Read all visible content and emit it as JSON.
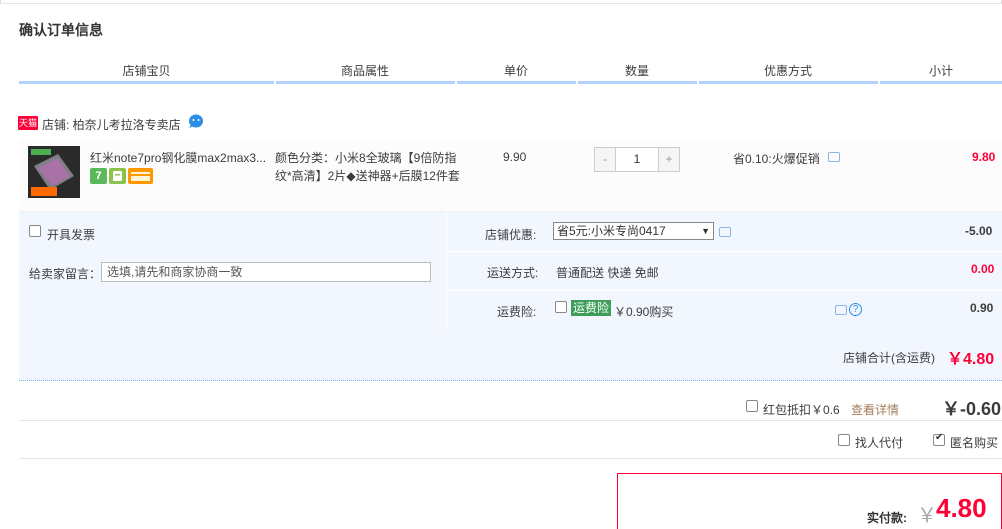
{
  "page": {
    "title": "确认订单信息",
    "columns": [
      "店铺宝贝",
      "商品属性",
      "单价",
      "数量",
      "优惠方式",
      "小计"
    ]
  },
  "shop": {
    "tag": "天猫",
    "label": "店铺: 柏奈儿考拉洛专卖店"
  },
  "item": {
    "name": "红米note7pro钢化膜max2max3...",
    "attrs": "颜色分类：小米8全玻璃【9倍防指纹*高清】2片◆送神器+后膜12件套",
    "price": "9.90",
    "quantity": "1",
    "minus": "-",
    "plus": "+",
    "promo": "省0.10:火爆促销",
    "subtotal": "9.80",
    "badge_text": "7"
  },
  "options": {
    "invoice_label": "开具发票",
    "memo_label": "给卖家留言：",
    "memo_value": "选填,请先和商家协商一致",
    "shop_discount_label": "店铺优惠:",
    "shop_discount_selected": "省5元:小米专尚0417",
    "shop_discount_amount": "-5.00",
    "delivery_label": "运送方式:",
    "delivery_value": "普通配送 快递 免邮",
    "delivery_amount": "0.00",
    "insurance_label": "运费险:",
    "insurance_tag": "运费险",
    "insurance_price": "￥0.90购买",
    "insurance_amount": "0.90"
  },
  "totals": {
    "shop_total_label": "店铺合计(含运费)",
    "shop_total_value": "￥4.80",
    "redpack_label": "红包抵扣￥0.6",
    "redpack_link": "查看详情",
    "redpack_value": "￥-0.60",
    "proxy_pay_label": "找人代付",
    "anon_label": "匿名购买",
    "pay_label": "实付款:",
    "pay_yen": "￥",
    "pay_value": "4.80"
  },
  "colors": {
    "accent_red": "#ff0036",
    "header_rule": "#b2d1ff",
    "option_bg": "#f2f7ff",
    "insurance_green": "#3c9e59"
  }
}
